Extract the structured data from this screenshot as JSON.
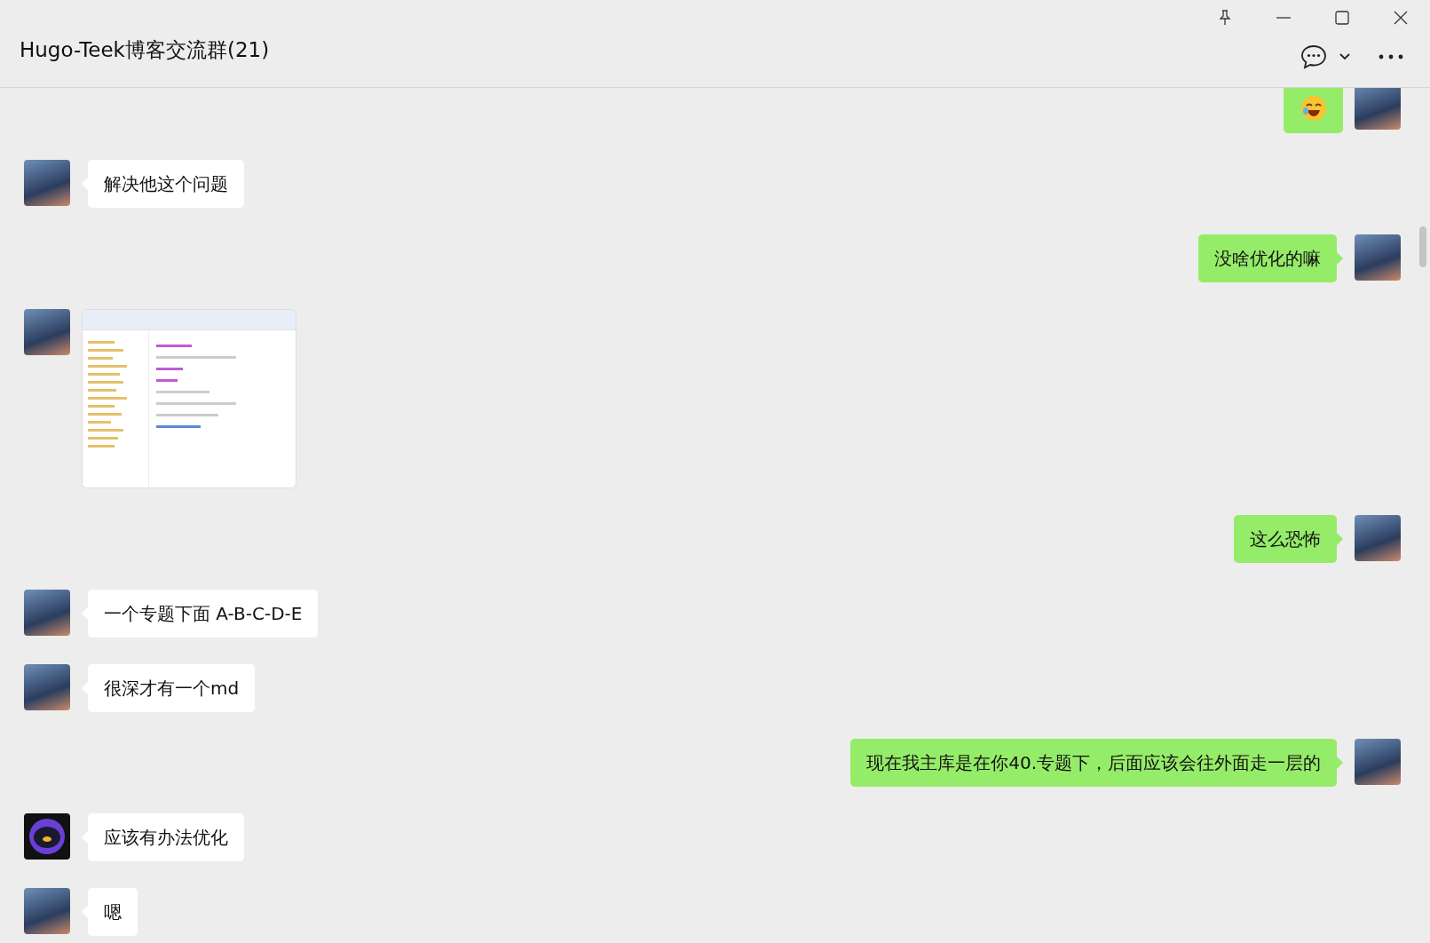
{
  "window": {
    "title": "Hugo-Teek博客交流群(21)"
  },
  "messages": [
    {
      "kind": "emoji",
      "self": true,
      "avatar": {
        "kind": "photo"
      }
    },
    {
      "kind": "text",
      "self": false,
      "avatar": {
        "kind": "photo"
      },
      "text": "解决他这个问题"
    },
    {
      "kind": "text",
      "self": true,
      "avatar": {
        "kind": "photo"
      },
      "text": "没啥优化的嘛"
    },
    {
      "kind": "image",
      "self": false,
      "avatar": {
        "kind": "photo"
      }
    },
    {
      "kind": "text",
      "self": true,
      "avatar": {
        "kind": "photo"
      },
      "text": "这么恐怖"
    },
    {
      "kind": "text",
      "self": false,
      "avatar": {
        "kind": "photo"
      },
      "text": "一个专题下面 A-B-C-D-E"
    },
    {
      "kind": "text",
      "self": false,
      "avatar": {
        "kind": "photo"
      },
      "text": "很深才有一个md"
    },
    {
      "kind": "text",
      "self": true,
      "avatar": {
        "kind": "photo"
      },
      "text": "现在我主库是在你40.专题下，后面应该会往外面走一层的"
    },
    {
      "kind": "text",
      "self": false,
      "avatar": {
        "kind": "robot"
      },
      "text": "应该有办法优化"
    },
    {
      "kind": "text",
      "self": false,
      "avatar": {
        "kind": "photo"
      },
      "text": "嗯"
    }
  ]
}
